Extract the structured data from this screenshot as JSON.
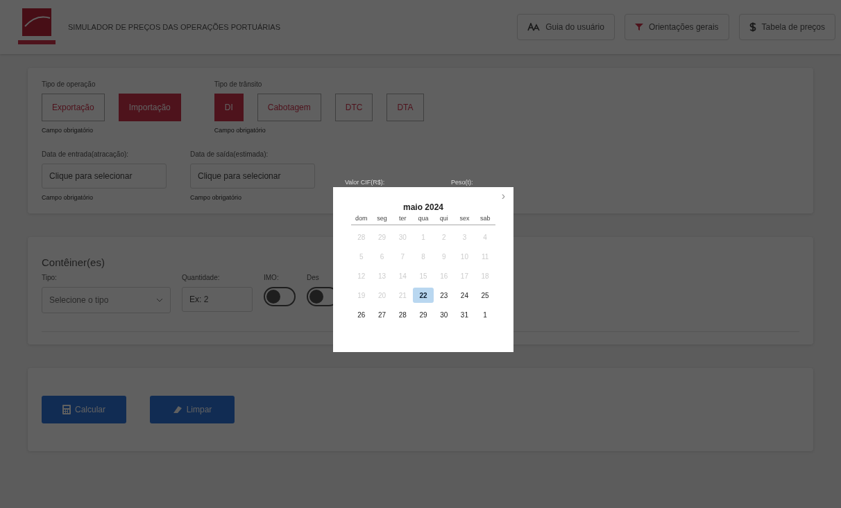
{
  "header": {
    "title": "SIMULADOR DE PREÇOS DAS OPERAÇÕES PORTUÁRIAS",
    "buttons": [
      {
        "kind": "guide",
        "label": "Guia do usuário"
      },
      {
        "kind": "info",
        "label": "Orientações gerais"
      },
      {
        "kind": "price",
        "label": "Tabela de preços"
      }
    ]
  },
  "operation": {
    "label": "Tipo de operação",
    "hint": "Campo obrigatório",
    "options": [
      {
        "label": "Exportação",
        "selected": false
      },
      {
        "label": "Importação",
        "selected": true
      }
    ]
  },
  "transit": {
    "label": "Tipo de trânsito",
    "hint": "Campo obrigatório",
    "options": [
      {
        "label": "DI",
        "selected": true
      },
      {
        "label": "Cabotagem",
        "selected": false
      },
      {
        "label": "DTC",
        "selected": false
      },
      {
        "label": "DTA",
        "selected": false
      }
    ]
  },
  "dates": [
    {
      "label": "Data de entrada(atracação):",
      "placeholder": "Clique para selecionar",
      "hint": "Campo obrigatório"
    },
    {
      "label": "Data de saída(estimada):",
      "placeholder": "Clique para selecionar",
      "hint": "Campo obrigatório"
    }
  ],
  "extra_labels": [
    "Valor CIF(R$):",
    "Peso(t):"
  ],
  "containers": {
    "title": "Contêiner(es)",
    "type_label": "Tipo:",
    "type_placeholder": "Selecione o tipo",
    "quantity_label": "Quantidade:",
    "quantity_placeholder": "Ex: 2",
    "toggles": [
      {
        "label": "IMO:",
        "on": false
      },
      {
        "label": "Des",
        "on": false
      }
    ]
  },
  "actions": [
    {
      "kind": "calc",
      "label": "Calcular"
    },
    {
      "kind": "clear",
      "label": "Limpar"
    }
  ],
  "calendar": {
    "next": "›",
    "month": "maio 2024",
    "weekdays": [
      "dom",
      "seg",
      "ter",
      "qua",
      "qui",
      "sex",
      "sab"
    ],
    "days": [
      {
        "label": "28",
        "disabled": true,
        "selected": false
      },
      {
        "label": "29",
        "disabled": true,
        "selected": false
      },
      {
        "label": "30",
        "disabled": true,
        "selected": false
      },
      {
        "label": "1",
        "disabled": true,
        "selected": false
      },
      {
        "label": "2",
        "disabled": true,
        "selected": false
      },
      {
        "label": "3",
        "disabled": true,
        "selected": false
      },
      {
        "label": "4",
        "disabled": true,
        "selected": false
      },
      {
        "label": "5",
        "disabled": true,
        "selected": false
      },
      {
        "label": "6",
        "disabled": true,
        "selected": false
      },
      {
        "label": "7",
        "disabled": true,
        "selected": false
      },
      {
        "label": "8",
        "disabled": true,
        "selected": false
      },
      {
        "label": "9",
        "disabled": true,
        "selected": false
      },
      {
        "label": "10",
        "disabled": true,
        "selected": false
      },
      {
        "label": "11",
        "disabled": true,
        "selected": false
      },
      {
        "label": "12",
        "disabled": true,
        "selected": false
      },
      {
        "label": "13",
        "disabled": true,
        "selected": false
      },
      {
        "label": "14",
        "disabled": true,
        "selected": false
      },
      {
        "label": "15",
        "disabled": true,
        "selected": false
      },
      {
        "label": "16",
        "disabled": true,
        "selected": false
      },
      {
        "label": "17",
        "disabled": true,
        "selected": false
      },
      {
        "label": "18",
        "disabled": true,
        "selected": false
      },
      {
        "label": "19",
        "disabled": true,
        "selected": false
      },
      {
        "label": "20",
        "disabled": true,
        "selected": false
      },
      {
        "label": "21",
        "disabled": true,
        "selected": false
      },
      {
        "label": "22",
        "disabled": false,
        "selected": true
      },
      {
        "label": "23",
        "disabled": false,
        "selected": false
      },
      {
        "label": "24",
        "disabled": false,
        "selected": false
      },
      {
        "label": "25",
        "disabled": false,
        "selected": false
      },
      {
        "label": "26",
        "disabled": false,
        "selected": false
      },
      {
        "label": "27",
        "disabled": false,
        "selected": false
      },
      {
        "label": "28",
        "disabled": false,
        "selected": false
      },
      {
        "label": "29",
        "disabled": false,
        "selected": false
      },
      {
        "label": "30",
        "disabled": false,
        "selected": false
      },
      {
        "label": "31",
        "disabled": false,
        "selected": false
      },
      {
        "label": "1",
        "disabled": false,
        "selected": false
      }
    ]
  }
}
